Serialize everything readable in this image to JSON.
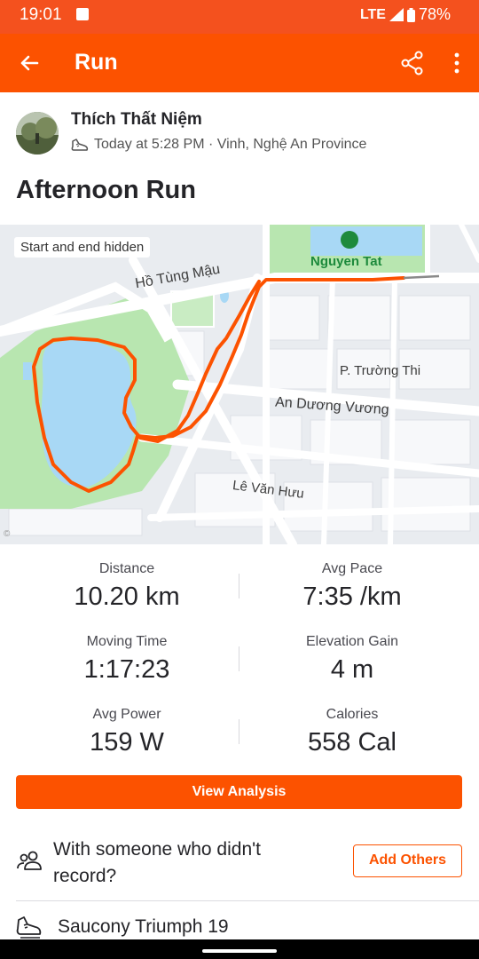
{
  "status": {
    "time": "19:01",
    "network": "LTE",
    "battery": "78%"
  },
  "app_bar": {
    "title": "Run",
    "icons": [
      "back-arrow-icon",
      "share-icon",
      "more-vertical-icon"
    ]
  },
  "athlete": {
    "name": "Thích Thất Niệm",
    "meta": "Today at 5:28 PM · Vinh, Nghệ An Province"
  },
  "activity": {
    "title": "Afternoon Run"
  },
  "map": {
    "privacy_badge": "Start and end hidden",
    "labels": {
      "park": "Nguyen Tat",
      "street_1": "Hồ Tùng Mậu",
      "street_2": "P. Trường Thi",
      "street_3": "An Dương Vương",
      "street_4": "Lê Văn Hưu"
    },
    "route_color": "#fc5200"
  },
  "stats": [
    {
      "label": "Distance",
      "value": "10.20 km"
    },
    {
      "label": "Avg Pace",
      "value": "7:35 /km"
    },
    {
      "label": "Moving Time",
      "value": "1:17:23"
    },
    {
      "label": "Elevation Gain",
      "value": "4 m"
    },
    {
      "label": "Avg Power",
      "value": "159 W"
    },
    {
      "label": "Calories",
      "value": "558 Cal"
    }
  ],
  "actions": {
    "view_analysis": "View Analysis",
    "with_others_text": "With someone who didn't record?",
    "add_others": "Add Others"
  },
  "gear": {
    "shoe": "Saucony Triumph 19"
  },
  "colors": {
    "brand": "#fc5200",
    "status_bar": "#f4511e"
  }
}
